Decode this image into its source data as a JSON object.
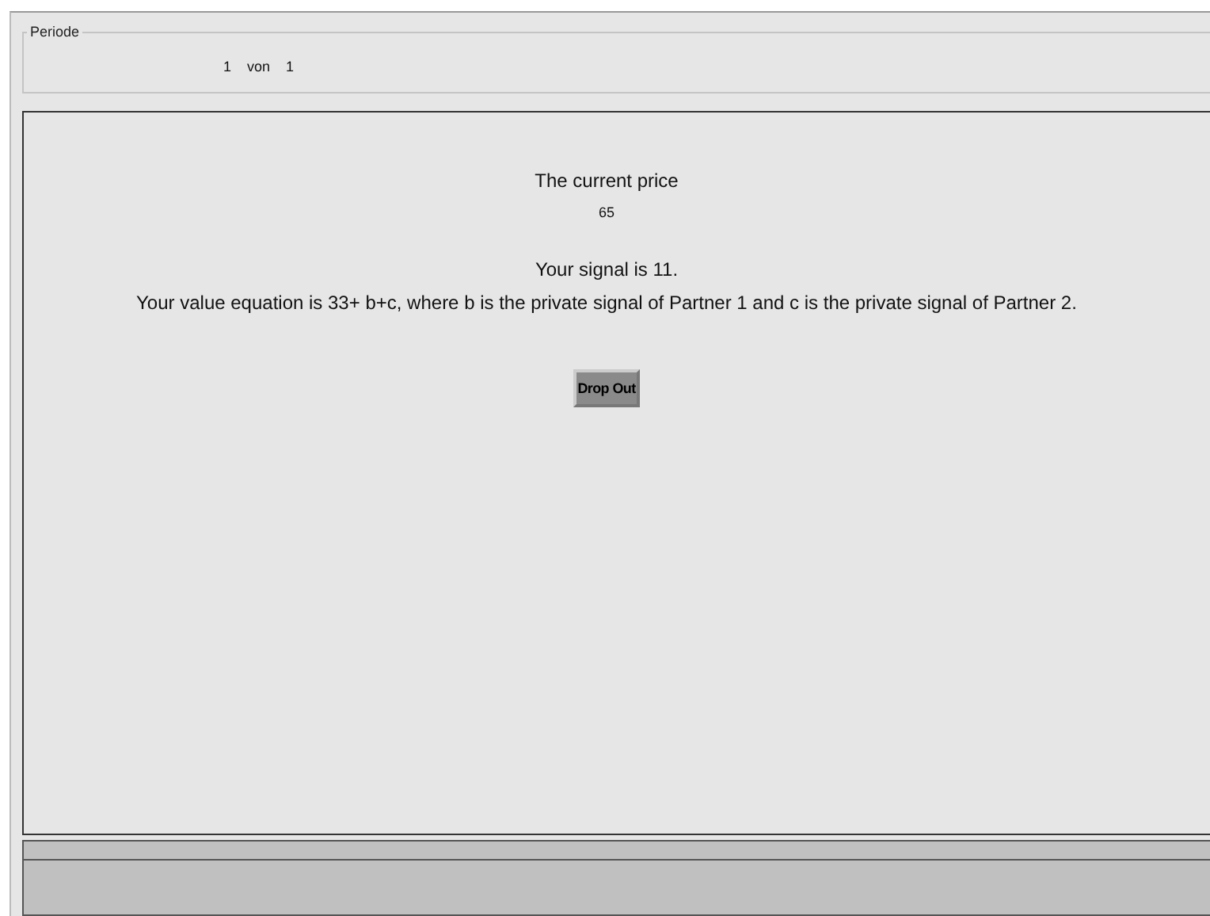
{
  "period": {
    "legend": "Periode",
    "current": "1",
    "separator": "von",
    "total": "1"
  },
  "main": {
    "price_label": "The current price",
    "price": "65",
    "signal": "Your signal is 11.",
    "equation": "Your value equation is 33+ b+c, where b is the private signal of Partner 1 and c is the private signal of Partner 2.",
    "button": "Drop Out"
  }
}
